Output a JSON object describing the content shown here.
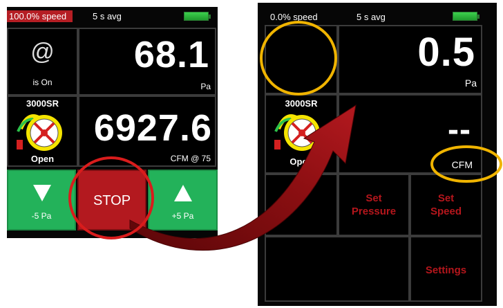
{
  "left_screen": {
    "status": {
      "speed": "100.0% speed",
      "avg": "5 s avg",
      "speed_fraction": 1.0
    },
    "pressure": {
      "value": "68.1",
      "unit": "Pa"
    },
    "device_icon_label": "@",
    "device_status": "is On",
    "fan": {
      "model": "3000SR",
      "state": "Open"
    },
    "flow": {
      "value": "6927.6",
      "unit": "CFM @ 75"
    },
    "buttons": {
      "minus": "-5 Pa",
      "stop": "STOP",
      "plus": "+5 Pa"
    }
  },
  "right_screen": {
    "status": {
      "speed": "0.0% speed",
      "avg": "5 s avg",
      "speed_fraction": 0.0
    },
    "pressure": {
      "value": "0.5",
      "unit": "Pa"
    },
    "fan": {
      "model": "3000SR",
      "state": "Open"
    },
    "flow": {
      "value": "--",
      "unit": "CFM"
    },
    "menu": {
      "set_pressure": "Set\nPressure",
      "set_speed": "Set\nSpeed",
      "settings": "Settings"
    }
  },
  "colors": {
    "highlight_circle_orange": "#f0b400",
    "highlight_circle_red": "#d91c1c",
    "arrow_dark_red": "#7d0a0c",
    "green_button": "#23b25a",
    "stop_red": "#b3191f",
    "menu_text_red": "#b5161c"
  }
}
